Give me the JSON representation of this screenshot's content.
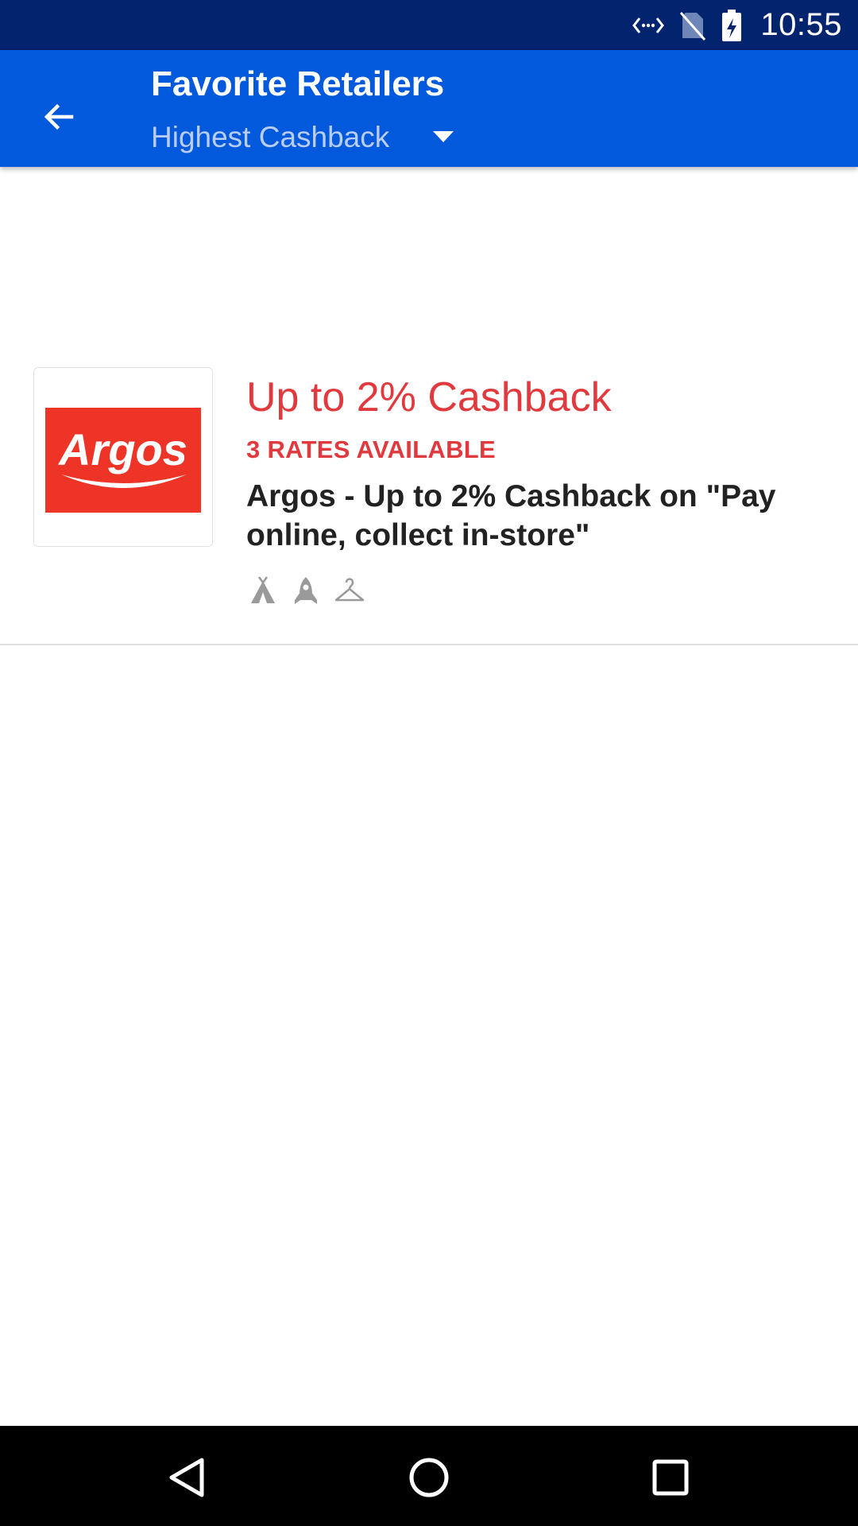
{
  "status_bar": {
    "time": "10:55",
    "icons": [
      "data-transfer-icon",
      "no-sim-icon",
      "battery-charging-icon"
    ]
  },
  "app_bar": {
    "back_icon": "arrow-back-icon",
    "title": "Favorite Retailers",
    "sort": {
      "selected": "Highest Cashback",
      "icon": "caret-down-icon"
    }
  },
  "retailers": [
    {
      "logo_text": "Argos",
      "cashback": "Up to 2% Cashback",
      "rates": "3 RATES AVAILABLE",
      "description": "Argos - Up to 2% Cashback on \"Pay online, collect in-store\"",
      "category_icons": [
        "tent-icon",
        "rocket-icon",
        "hanger-icon"
      ]
    }
  ],
  "nav_bar": {
    "buttons": [
      "back-triangle-icon",
      "home-circle-icon",
      "recents-square-icon"
    ]
  },
  "colors": {
    "status_bar": "#02236e",
    "app_bar": "#0259db",
    "accent_red": "#e13a3e",
    "argos_red": "#ee3327"
  }
}
